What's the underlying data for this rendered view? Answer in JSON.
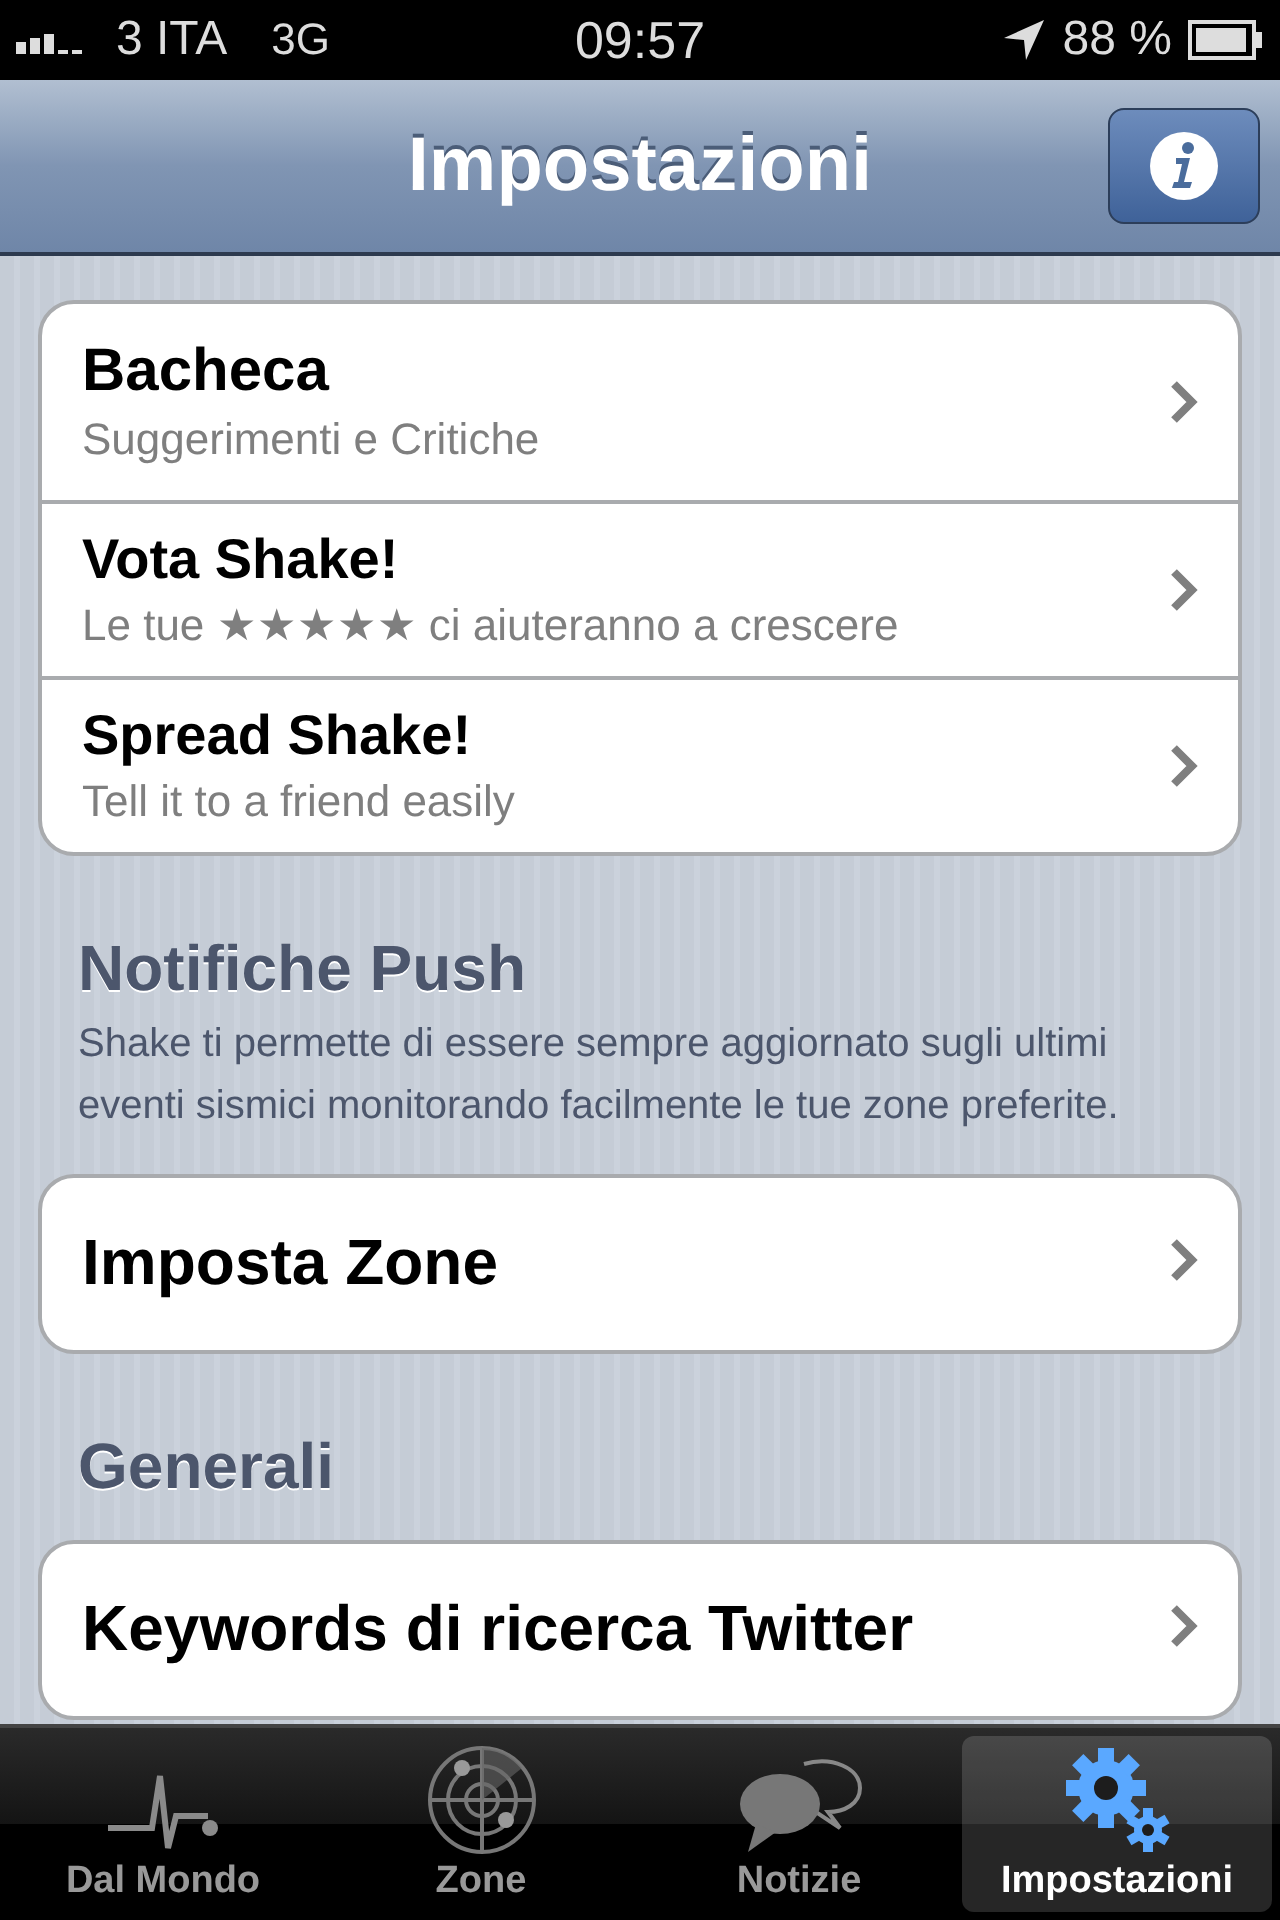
{
  "status_bar": {
    "carrier": "3 ITA",
    "network": "3G",
    "time": "09:57",
    "battery": "88 %"
  },
  "nav_bar": {
    "title": "Impostazioni"
  },
  "sections": [
    {
      "kind": "group",
      "rows": [
        {
          "title": "Bacheca",
          "subtitle": "Suggerimenti e Critiche"
        },
        {
          "title": "Vota Shake!",
          "subtitle": "Le tue ★★★★★ ci aiuteranno a crescere"
        },
        {
          "title": "Spread Shake!",
          "subtitle": "Tell it to a friend easily"
        }
      ]
    },
    {
      "kind": "header",
      "title": "Notifiche Push",
      "description": "Shake ti permette di essere sempre aggiornato sugli ultimi eventi sismici monitorando facilmente le tue zone preferite."
    },
    {
      "kind": "group",
      "rows": [
        {
          "title": "Imposta Zone"
        }
      ]
    },
    {
      "kind": "header",
      "title": "Generali"
    },
    {
      "kind": "group",
      "rows": [
        {
          "title": "Keywords di ricerca Twitter"
        }
      ]
    }
  ],
  "tab_bar": [
    {
      "label": "Dal Mondo",
      "kind": "pulse",
      "selected": false
    },
    {
      "label": "Zone",
      "kind": "radar",
      "selected": false
    },
    {
      "label": "Notizie",
      "kind": "bubbles",
      "selected": false
    },
    {
      "label": "Impostazioni",
      "kind": "gears",
      "selected": true
    }
  ]
}
